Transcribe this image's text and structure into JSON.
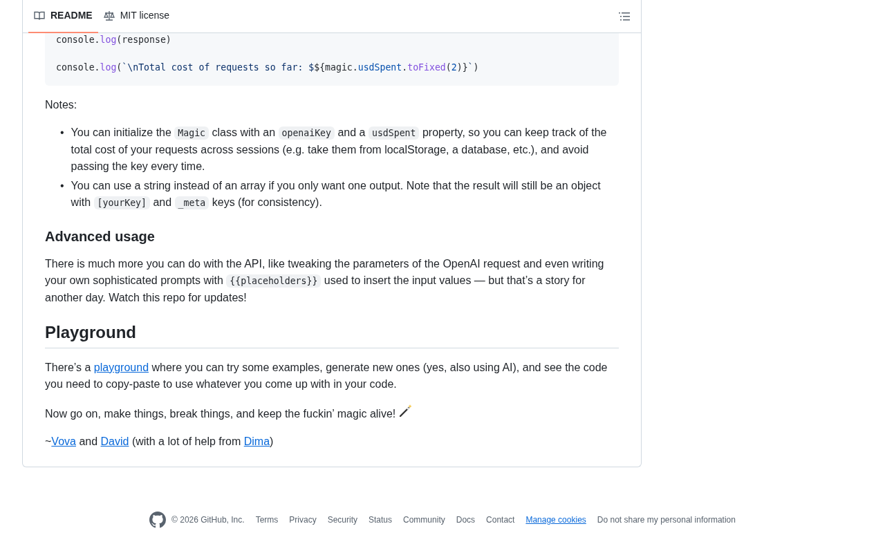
{
  "tabs": [
    {
      "label": "README",
      "kind": "book",
      "selected": true
    },
    {
      "label": "MIT license",
      "kind": "scale",
      "selected": false
    }
  ],
  "code_lines": [
    {
      "kind": "code",
      "tokens": [
        {
          "kind": "plain",
          "text": "console."
        },
        {
          "kind": "fn",
          "text": "log"
        },
        {
          "kind": "plain",
          "text": "(response)"
        }
      ]
    },
    {
      "kind": "blank"
    },
    {
      "kind": "code",
      "tokens": [
        {
          "kind": "plain",
          "text": "console."
        },
        {
          "kind": "fn",
          "text": "log"
        },
        {
          "kind": "plain",
          "text": "("
        },
        {
          "kind": "str",
          "text": "`\\nTotal cost of requests so far: $"
        },
        {
          "kind": "plain",
          "text": "${magic."
        },
        {
          "kind": "prop",
          "text": "usdSpent"
        },
        {
          "kind": "plain",
          "text": "."
        },
        {
          "kind": "fn",
          "text": "toFixed"
        },
        {
          "kind": "plain",
          "text": "("
        },
        {
          "kind": "prop",
          "text": "2"
        },
        {
          "kind": "plain",
          "text": ")}"
        },
        {
          "kind": "str",
          "text": "`"
        },
        {
          "kind": "plain",
          "text": ")"
        }
      ]
    }
  ],
  "blocks": [
    {
      "kind": "p",
      "parts": [
        {
          "kind": "text",
          "text": "Notes:"
        }
      ]
    },
    {
      "kind": "list",
      "marker": "•",
      "items": [
        [
          {
            "kind": "text",
            "text": "You can initialize the "
          },
          {
            "kind": "code",
            "text": "Magic"
          },
          {
            "kind": "text",
            "text": " class with an "
          },
          {
            "kind": "code",
            "text": "openaiKey"
          },
          {
            "kind": "text",
            "text": " and a "
          },
          {
            "kind": "code",
            "text": "usdSpent"
          },
          {
            "kind": "text",
            "text": " property, so you can keep track of the total cost of your requests across sessions (e.g. take them from localStorage, a database, etc.), and avoid passing the key every time."
          }
        ],
        [
          {
            "kind": "text",
            "text": "You can use a string instead of an array if you only want one output. Note that the result will still be an object with "
          },
          {
            "kind": "code",
            "text": "[yourKey]"
          },
          {
            "kind": "text",
            "text": " and "
          },
          {
            "kind": "code",
            "text": "_meta"
          },
          {
            "kind": "text",
            "text": " keys (for consistency)."
          }
        ]
      ]
    },
    {
      "kind": "h3",
      "parts": [
        {
          "kind": "text",
          "text": "Advanced usage"
        }
      ]
    },
    {
      "kind": "p",
      "parts": [
        {
          "kind": "text",
          "text": "There is much more you can do with the API, like tweaking the parameters of the OpenAI request and even writing your own sophisticated prompts with "
        },
        {
          "kind": "code",
          "text": "{{placeholders}}"
        },
        {
          "kind": "text",
          "text": " used to insert the input values — but that’s a story for another day. Watch this repo for updates!"
        }
      ]
    },
    {
      "kind": "h2",
      "parts": [
        {
          "kind": "text",
          "text": "Playground"
        }
      ]
    },
    {
      "kind": "p",
      "parts": [
        {
          "kind": "text",
          "text": "There’s a "
        },
        {
          "kind": "link",
          "text": "playground"
        },
        {
          "kind": "text",
          "text": " where you can try some examples, generate new ones (yes, also using AI), and see the code you need to copy-paste to use whatever you come up with in your code."
        }
      ]
    },
    {
      "kind": "p",
      "parts": [
        {
          "kind": "text",
          "text": "Now go on, make things, break things, and keep the fuckin’ magic alive! "
        },
        {
          "kind": "wand"
        }
      ]
    },
    {
      "kind": "p",
      "parts": [
        {
          "kind": "text",
          "text": "~"
        },
        {
          "kind": "link",
          "text": "Vova"
        },
        {
          "kind": "text",
          "text": " and "
        },
        {
          "kind": "link",
          "text": "David"
        },
        {
          "kind": "text",
          "text": " (with a lot of help from "
        },
        {
          "kind": "link",
          "text": "Dima"
        },
        {
          "kind": "text",
          "text": ")"
        }
      ]
    }
  ],
  "footer": {
    "copyright": "© 2026 GitHub, Inc.",
    "links": [
      {
        "text": "Terms",
        "kind": "plain"
      },
      {
        "text": "Privacy",
        "kind": "plain"
      },
      {
        "text": "Security",
        "kind": "plain"
      },
      {
        "text": "Status",
        "kind": "plain"
      },
      {
        "text": "Community",
        "kind": "plain"
      },
      {
        "text": "Docs",
        "kind": "plain"
      },
      {
        "text": "Contact",
        "kind": "plain"
      },
      {
        "text": "Manage cookies",
        "kind": "button"
      },
      {
        "text": "Do not share my personal information",
        "kind": "plain"
      }
    ]
  }
}
